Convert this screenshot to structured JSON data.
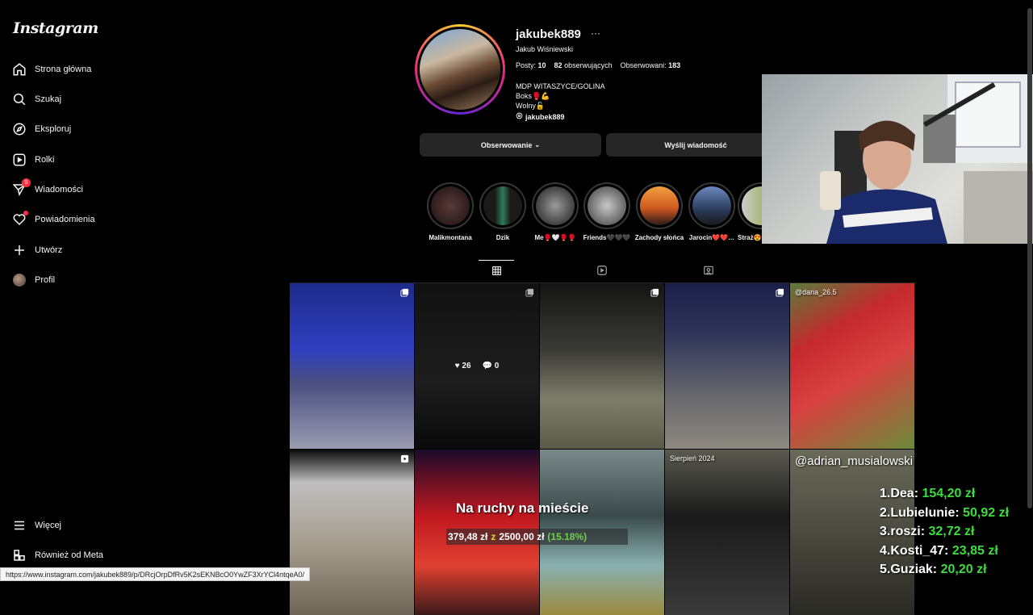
{
  "sidebar": {
    "logo": "Instagram",
    "items": [
      {
        "label": "Strona główna",
        "icon": "home-icon"
      },
      {
        "label": "Szukaj",
        "icon": "search-icon"
      },
      {
        "label": "Eksploruj",
        "icon": "compass-icon"
      },
      {
        "label": "Rolki",
        "icon": "reels-icon"
      },
      {
        "label": "Wiadomości",
        "icon": "messenger-icon",
        "badge": "5"
      },
      {
        "label": "Powiadomienia",
        "icon": "heart-icon"
      },
      {
        "label": "Utwórz",
        "icon": "plus-icon"
      },
      {
        "label": "Profil",
        "icon": "avatar"
      }
    ],
    "bottom_items": [
      {
        "label": "Więcej",
        "icon": "menu-icon"
      },
      {
        "label": "Również od Meta",
        "icon": "meta-icon"
      }
    ]
  },
  "profile": {
    "username": "jakubek889",
    "more": "···",
    "full_name": "Jakub Wiśniewski",
    "posts_label": "Posty:",
    "posts_count": "10",
    "followers_count": "82",
    "followers_label": "obserwujących",
    "following_label": "Obserwowani:",
    "following_count": "183",
    "bio": [
      "MDP WITASZYCE/GOLINA",
      "Boks🥊💪",
      "Wolny🔓"
    ],
    "threads_handle": "jakubek889",
    "follow_button": "Obserwowanie",
    "message_button": "Wyślij wiadomość"
  },
  "highlights": [
    {
      "label": "Malikmontana",
      "color": "#3a2424"
    },
    {
      "label": "Dzik",
      "color": "#2f5a44"
    },
    {
      "label": "Me🥊🤍🥊🥊",
      "color": "#6a6a6a"
    },
    {
      "label": "Friends🖤🖤🖤",
      "color": "#9a9a9a"
    },
    {
      "label": "Zachody słońca",
      "color": "#e07a2e"
    },
    {
      "label": "Jarocin❤️❤️…",
      "color": "#4a6fa0"
    },
    {
      "label": "Straż😍",
      "color": "#8aa22a"
    }
  ],
  "tabs": [
    {
      "icon": "grid-icon",
      "active": true
    },
    {
      "icon": "reels-tab-icon",
      "active": false
    },
    {
      "icon": "tagged-icon",
      "active": false
    }
  ],
  "posts": [
    {
      "bg": "linear-gradient(180deg,#1d2b8a 0%,#2f3fc0 40%,#4a4e80 60%,#9a9cb0 100%)",
      "icon": "carousel-icon"
    },
    {
      "bg": "linear-gradient(180deg,#1a1a1a 0%,#2a2a2a 60%,#0e0e0e 100%)",
      "icon": "carousel-icon",
      "likes": "26",
      "comments": "0"
    },
    {
      "bg": "linear-gradient(180deg,#141414 0%,#3a3a36 40%,#7d7e6a 70%,#5a5b48 100%)",
      "icon": "carousel-icon"
    },
    {
      "bg": "linear-gradient(180deg,#1a2048 0%,#2e3458 30%,#6a6a6e 70%,#8d8980 100%)",
      "icon": "carousel-icon"
    },
    {
      "bg": "linear-gradient(150deg,#5a7a3a 0%,#c42a2e 30%,#d94040 55%,#6b8a3a 100%)",
      "caption": "@daria_26.5"
    },
    {
      "bg": "linear-gradient(180deg,#0a0a0a 0%,#c0bfc0 20%,#a29a8a 60%,#6e6455 100%)",
      "icon": "reel-icon"
    },
    {
      "bg": "linear-gradient(180deg,#1a0a2a 0%,#c01820 40%,#e04030 70%,#3a1a1a 100%)"
    },
    {
      "bg": "linear-gradient(180deg,#7a8a8a 0%,#3a4a4a 40%,#8ab0b0 70%,#9a8a40 100%)"
    },
    {
      "bg": "linear-gradient(180deg,#5a5a50 0%,#1a1a1a 40%,#3a3a3a 100%)",
      "caption": "Sierpień 2024"
    },
    {
      "bg": "linear-gradient(180deg,#6a6a5a 0%,#4a4a40 50%,#2a2a24 100%)",
      "caption": "@adrian_musialowski"
    }
  ],
  "overlay": {
    "donation_title": "Na ruchy na mieście",
    "donation_current": "379,48 zł",
    "donation_sep": "z",
    "donation_goal": "2500,00 zł",
    "donation_pct": "(15.18%)",
    "leaderboard": [
      {
        "rank_name": "1.Dea:",
        "amount": "154,20 zł"
      },
      {
        "rank_name": "2.Lubielunie:",
        "amount": "50,92 zł"
      },
      {
        "rank_name": "3.roszi:",
        "amount": "32,72 zł"
      },
      {
        "rank_name": "4.Kosti_47:",
        "amount": "23,85 zł"
      },
      {
        "rank_name": "5.Guziak:",
        "amount": "20,20 zł"
      }
    ]
  },
  "status_url": "https://www.instagram.com/jakubek889/p/DRcjOrpDfRv5K2sEKNBcO0YwZF3XrYCl4ntqeA0/"
}
